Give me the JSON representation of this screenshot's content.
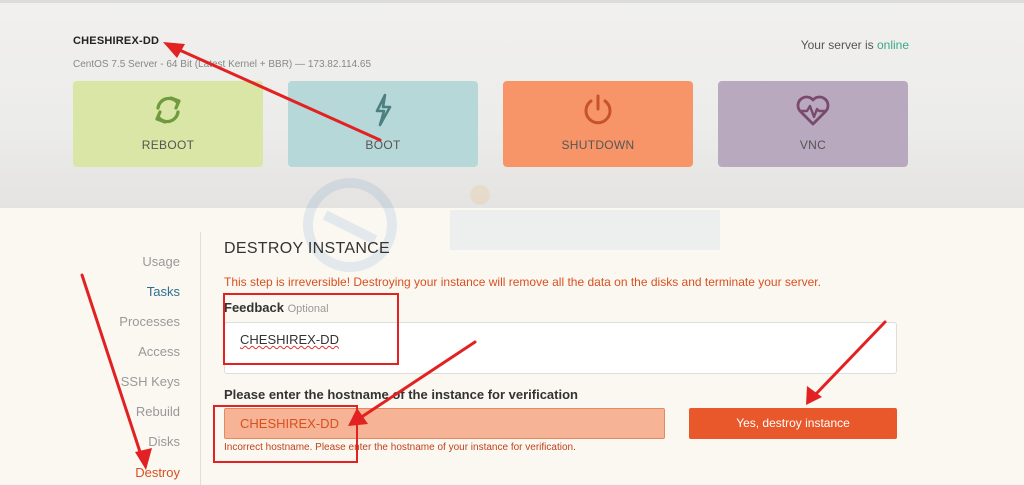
{
  "server": {
    "name": "CHESHIREX-DD",
    "description": "CentOS 7.5 Server - 64 Bit (Latest Kernel + BBR) — 173.82.114.65",
    "status_prefix": "Your server is ",
    "status_value": "online"
  },
  "actions": [
    {
      "label": "REBOOT",
      "icon": "refresh-icon",
      "color": "#d9e6a5"
    },
    {
      "label": "BOOT",
      "icon": "lightning-icon",
      "color": "#b7d8d8"
    },
    {
      "label": "SHUTDOWN",
      "icon": "power-icon",
      "color": "#f79568"
    },
    {
      "label": "VNC",
      "icon": "heart-monitor-icon",
      "color": "#b9a9be"
    }
  ],
  "sidebar": {
    "items": [
      "Usage",
      "Tasks",
      "Processes",
      "Access",
      "SSH Keys",
      "Rebuild",
      "Disks",
      "Destroy"
    ]
  },
  "destroy": {
    "title": "DESTROY INSTANCE",
    "warning": "This step is irreversible! Destroying your instance will remove all the data on the disks and terminate your server.",
    "feedback_label": "Feedback",
    "feedback_optional": "Optional",
    "feedback_value": "CHESHIREX-DD",
    "verify_label": "Please enter the hostname of the instance for verification",
    "hostname_value": "CHESHIREX-DD",
    "error": "Incorrect hostname. Please enter the hostname of your instance for verification.",
    "button": "Yes, destroy instance"
  },
  "colors": {
    "accent": "#e8582a",
    "online": "#3aa889",
    "annotation": "#e22222"
  }
}
